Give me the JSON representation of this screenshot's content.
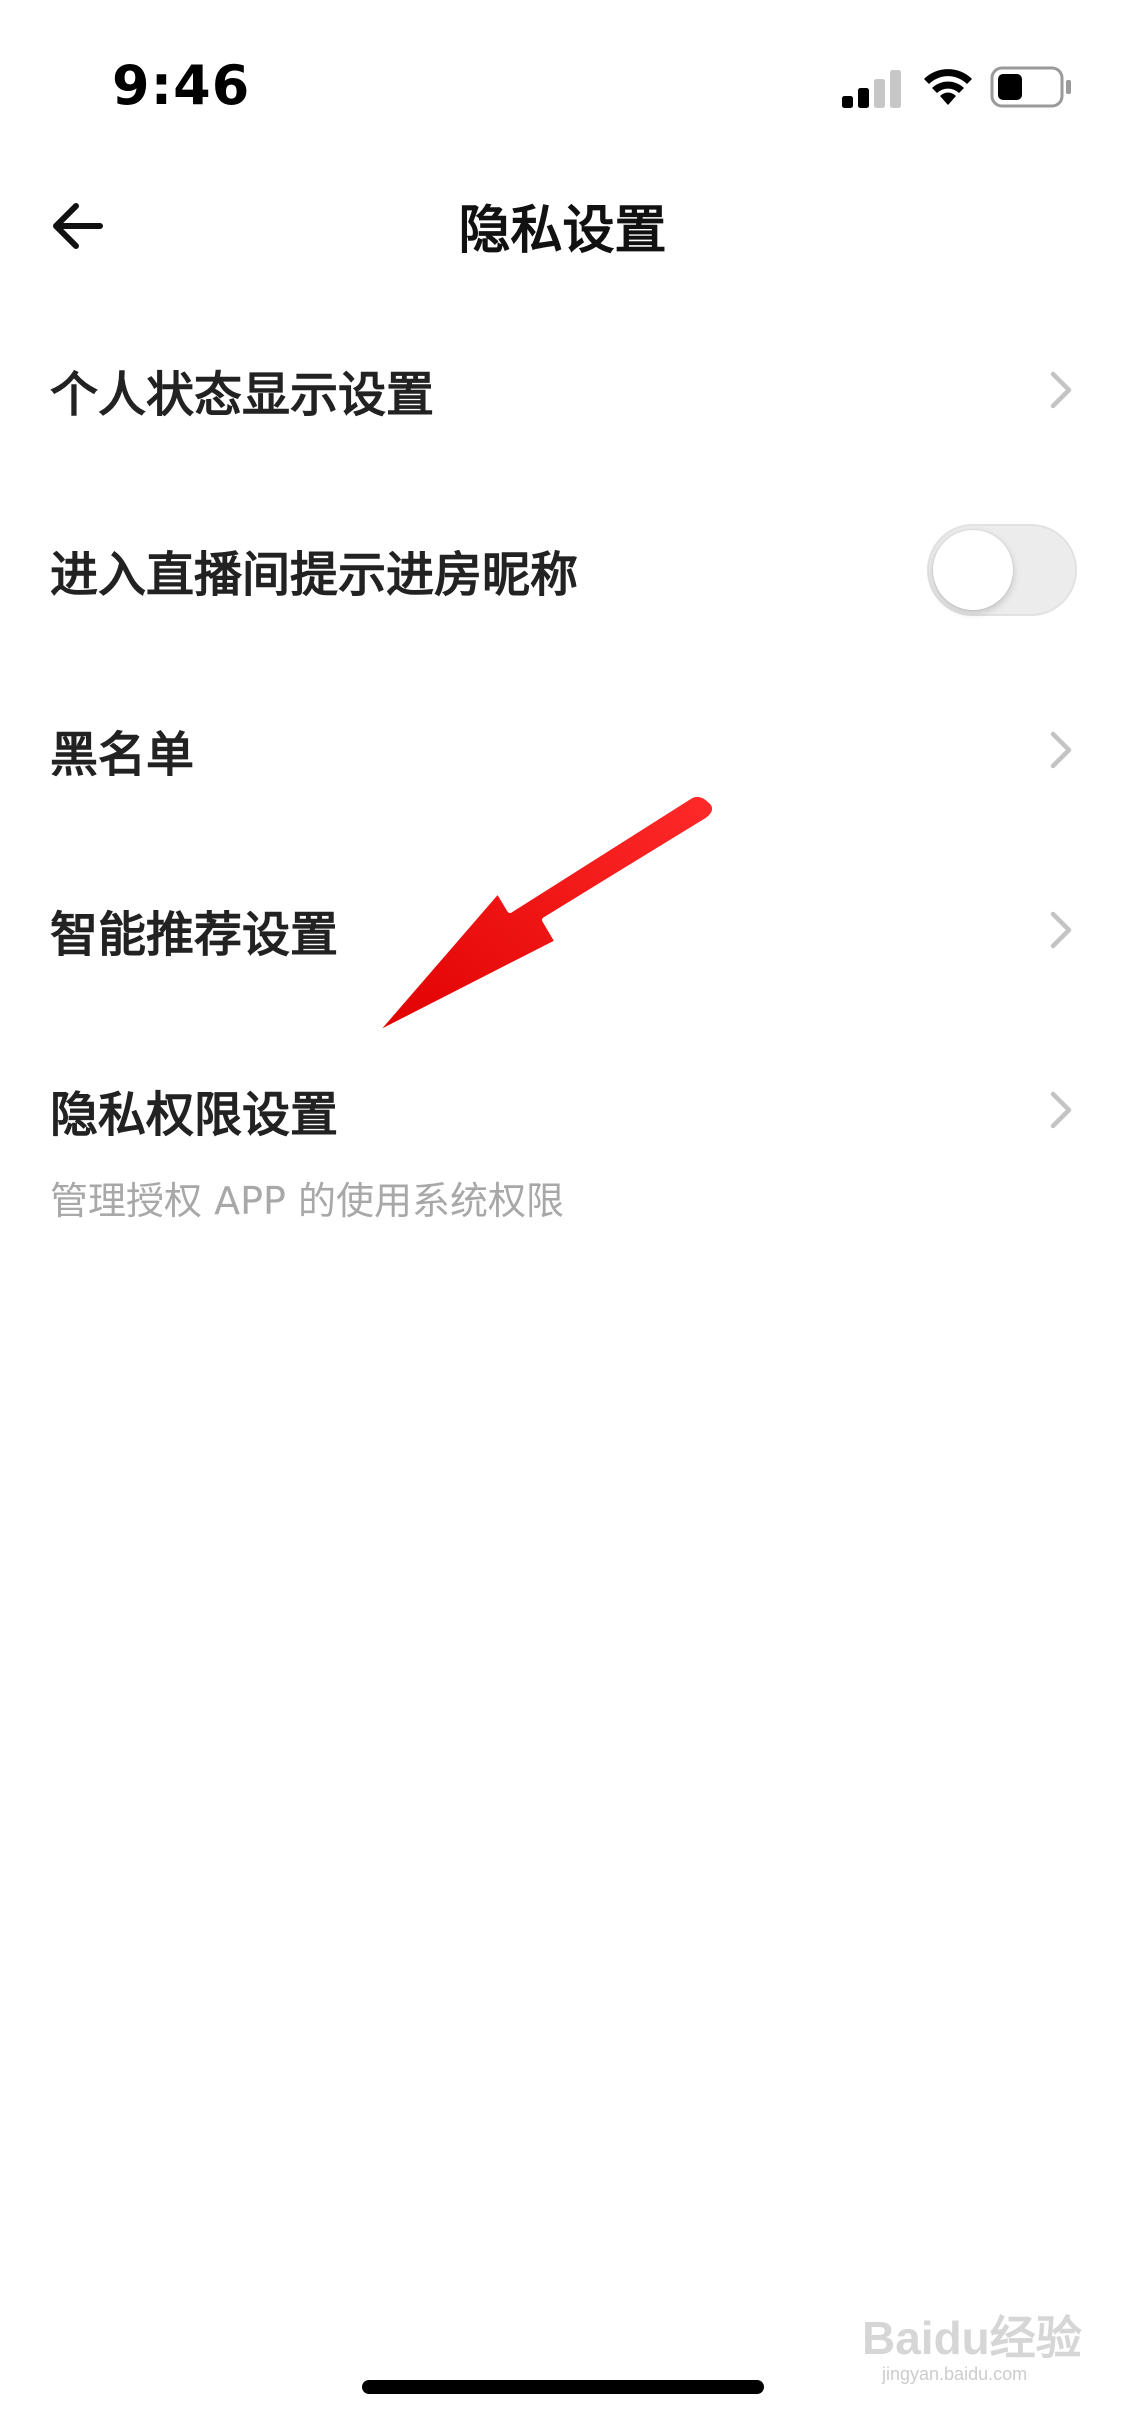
{
  "status_bar": {
    "time": "9:46",
    "signal_icon": "cellular-signal-icon",
    "wifi_icon": "wifi-icon",
    "battery_icon": "battery-icon",
    "battery_level": 0.35
  },
  "header": {
    "back_icon": "back-arrow-icon",
    "title": "隐私设置"
  },
  "settings": {
    "items": [
      {
        "label": "个人状态显示设置",
        "control": "chevron"
      },
      {
        "label": "进入直播间提示进房昵称",
        "control": "toggle",
        "enabled": false
      },
      {
        "label": "黑名单",
        "control": "chevron"
      },
      {
        "label": "智能推荐设置",
        "control": "chevron"
      },
      {
        "label": "隐私权限设置",
        "control": "chevron",
        "description": "管理授权 APP 的使用系统权限"
      }
    ]
  },
  "annotation": {
    "type": "arrow",
    "color": "#ee0a0a",
    "points_to": "隐私权限设置"
  },
  "watermark": {
    "text": "Baidu经验",
    "sub": "jingyan.baidu.com"
  },
  "colors": {
    "background": "#ffffff",
    "label": "#222222",
    "description": "#a8a8a8",
    "chevron": "#c4c4c4",
    "toggle_track": "#ececec"
  }
}
